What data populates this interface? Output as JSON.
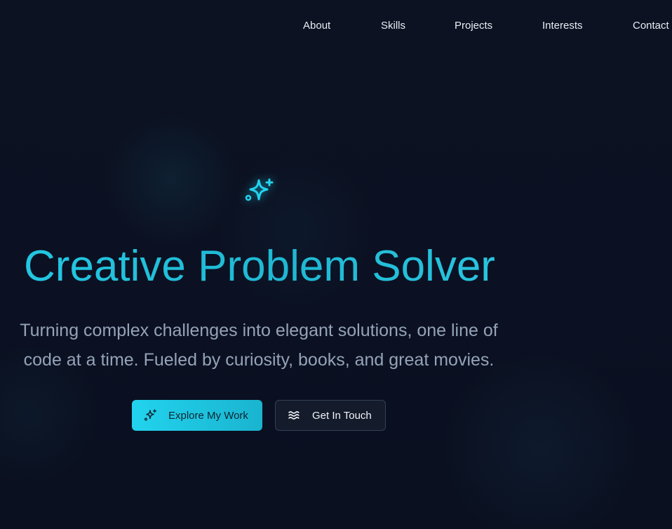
{
  "nav": {
    "items": [
      {
        "label": "About"
      },
      {
        "label": "Skills"
      },
      {
        "label": "Projects"
      },
      {
        "label": "Interests"
      },
      {
        "label": "Contact"
      }
    ]
  },
  "hero": {
    "icon": "sparkles-icon",
    "title": "Creative Problem Solver",
    "subtitle_line1": "Turning complex challenges into elegant solutions, one line of",
    "subtitle_line2": "code at a time. Fueled by curiosity, books, and great movies.",
    "primary_button": {
      "label": "Explore My Work",
      "icon": "sparkles-icon"
    },
    "secondary_button": {
      "label": "Get In Touch",
      "icon": "waves-icon"
    }
  },
  "colors": {
    "background": "#0b1020",
    "accent": "#22d3ee",
    "text_muted": "#94a3b8",
    "nav_text": "#e8edf5"
  }
}
